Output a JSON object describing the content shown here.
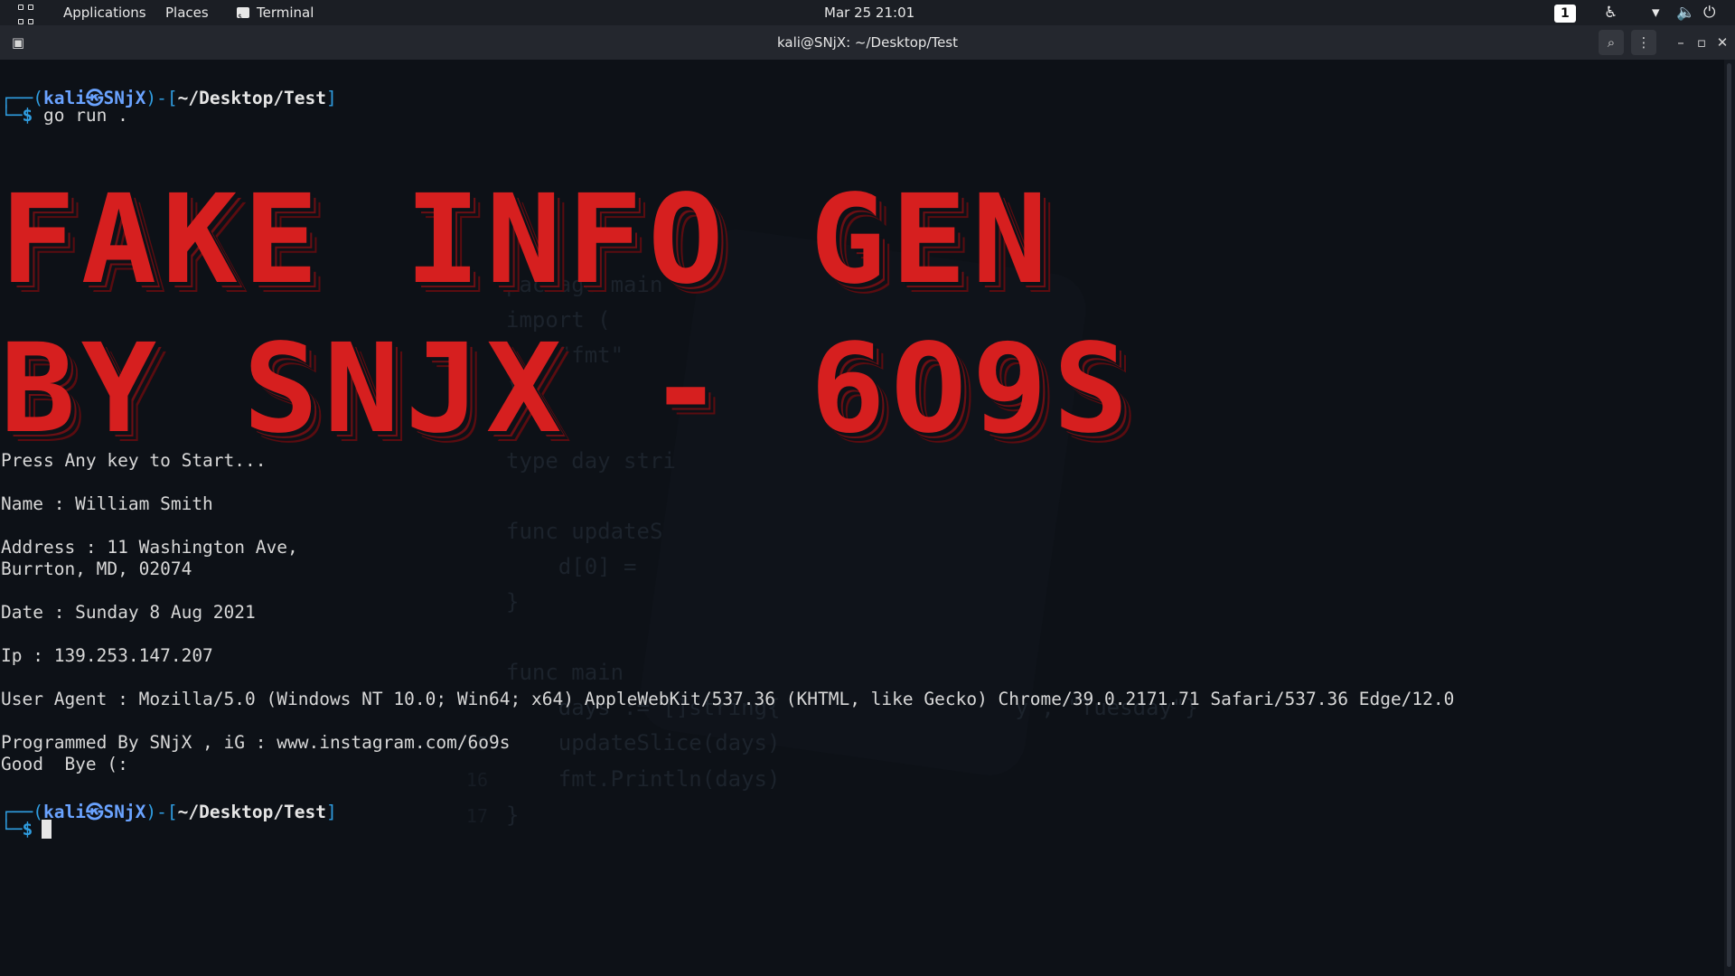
{
  "topbar": {
    "applications": "Applications",
    "places": "Places",
    "terminal": "Terminal",
    "datetime": "Mar 25  21:01",
    "workspace": "1"
  },
  "window": {
    "title": "kali@SNjX: ~/Desktop/Test"
  },
  "prompt": {
    "open": "┌──(",
    "user": "kali",
    "at": "㉿",
    "host": "SNjX",
    "mid": ")-[",
    "path": "~/Desktop/Test",
    "close": "]",
    "line2": "└─",
    "dollar": "$",
    "command": " go run ."
  },
  "banner": {
    "line1": "FAKE INFO GEN",
    "line2": "BY SNJX - 6O9S"
  },
  "output": {
    "start": "Press Any key to Start...",
    "name": "Name : William Smith",
    "address1": "Address : 11 Washington Ave,",
    "address2": "Burrton, MD, 02074",
    "date": "Date : Sunday 8 Aug 2021",
    "ip": "Ip : 139.253.147.207",
    "user_agent": "User Agent : Mozilla/5.0 (Windows NT 10.0; Win64; x64) AppleWebKit/537.36 (KHTML, like Gecko) Chrome/39.0.2171.71 Safari/537.36 Edge/12.0",
    "credit": "Programmed By SNjX , iG : www.instagram.com/6o9s",
    "bye": "Good  Bye (:"
  },
  "background_code": [
    {
      "n": "",
      "t": "package main"
    },
    {
      "n": "",
      "t": "import ("
    },
    {
      "n": "",
      "t": "    \"fmt\""
    },
    {
      "n": "",
      "t": ")"
    },
    {
      "n": "",
      "t": ""
    },
    {
      "n": "",
      "t": "type day stri"
    },
    {
      "n": "",
      "t": ""
    },
    {
      "n": "",
      "t": "func updateS"
    },
    {
      "n": "",
      "t": "    d[0] ="
    },
    {
      "n": "",
      "t": "}"
    },
    {
      "n": "",
      "t": ""
    },
    {
      "n": "",
      "t": "func main"
    },
    {
      "n": "",
      "t": "    days := []string{                  y\", \"Tuesday\"}"
    },
    {
      "n": "15",
      "t": "    updateSlice(days)"
    },
    {
      "n": "16",
      "t": "    fmt.Println(days)"
    },
    {
      "n": "17",
      "t": "}"
    }
  ]
}
